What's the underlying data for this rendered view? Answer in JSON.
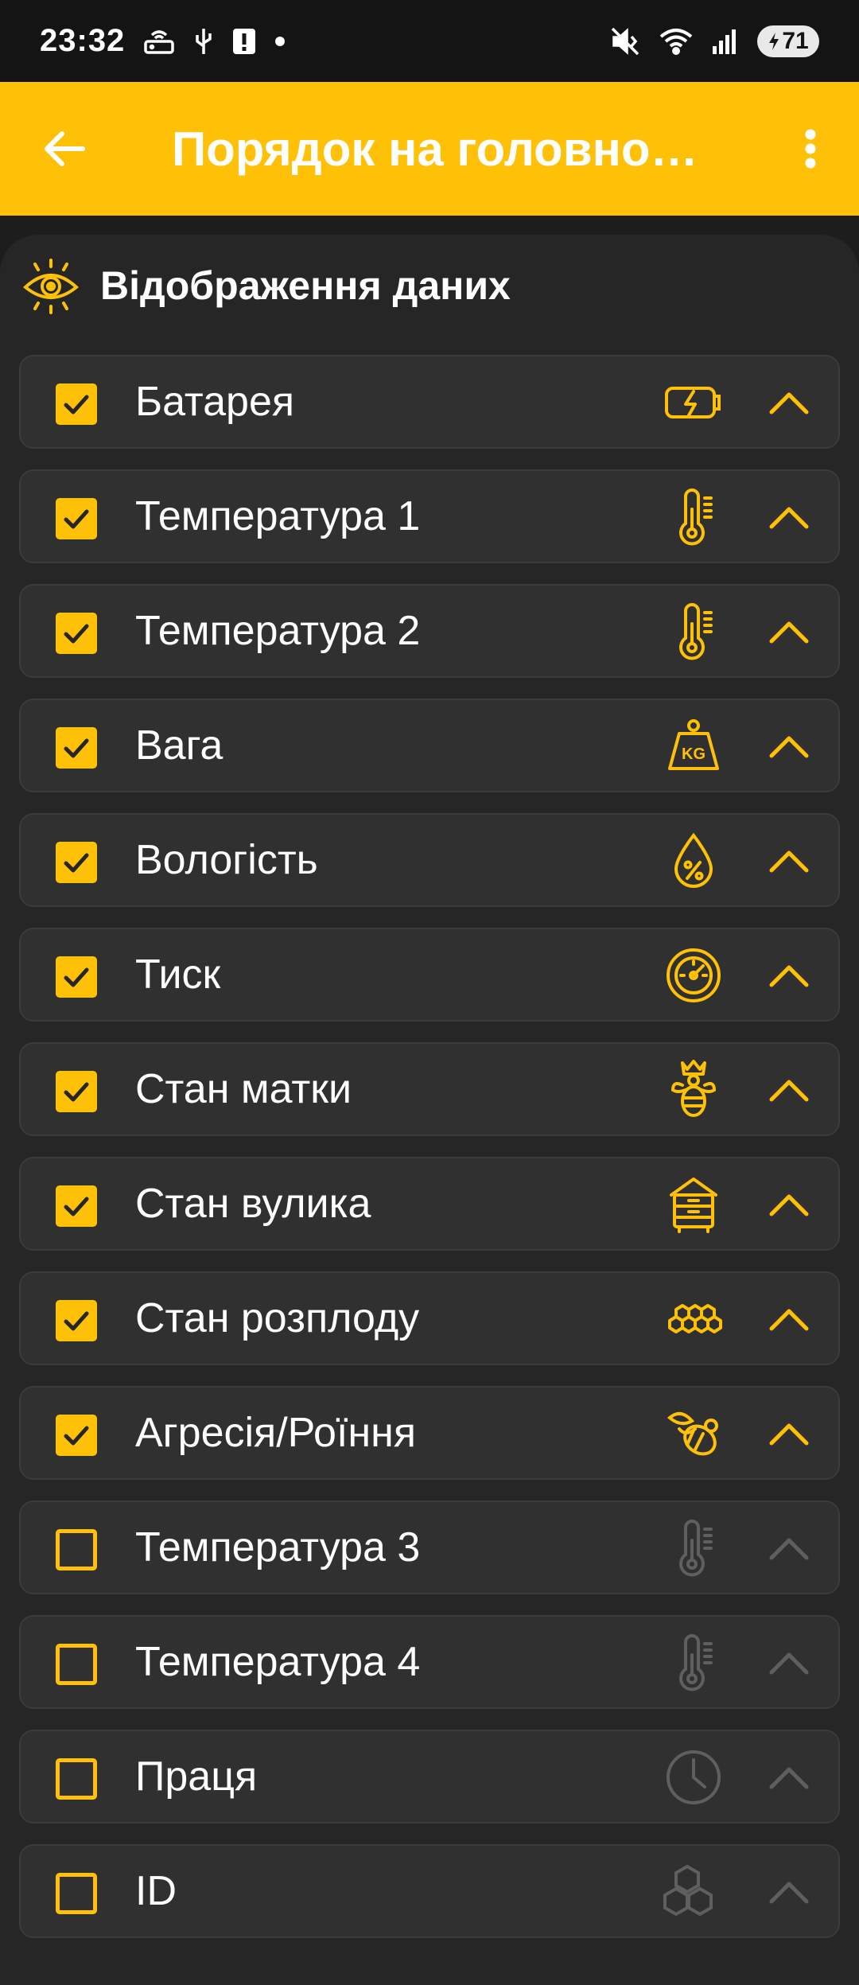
{
  "status_bar": {
    "time": "23:32",
    "icons_left": [
      "router-icon",
      "usb-icon",
      "alert-icon",
      "dot-icon"
    ],
    "icons_right": [
      "mute-vibrate-icon",
      "wifi-icon",
      "signal-icon"
    ],
    "battery": "71"
  },
  "app_bar": {
    "title": "Порядок на головно…",
    "background": "#ffc107"
  },
  "section": {
    "title": "Відображення даних",
    "icon": "eye-icon"
  },
  "colors": {
    "accent": "#ffc107",
    "disabled": "#5f5f5f"
  },
  "items": [
    {
      "label": "Батарея",
      "checked": true,
      "icon": "battery-charging-icon"
    },
    {
      "label": "Температура 1",
      "checked": true,
      "icon": "thermometer-icon"
    },
    {
      "label": "Температура 2",
      "checked": true,
      "icon": "thermometer-icon"
    },
    {
      "label": "Вага",
      "checked": true,
      "icon": "weight-kg-icon"
    },
    {
      "label": "Вологість",
      "checked": true,
      "icon": "humidity-icon"
    },
    {
      "label": "Тиск",
      "checked": true,
      "icon": "pressure-gauge-icon"
    },
    {
      "label": "Стан матки",
      "checked": true,
      "icon": "queen-bee-icon"
    },
    {
      "label": "Стан вулика",
      "checked": true,
      "icon": "beehive-icon"
    },
    {
      "label": "Стан розплоду",
      "checked": true,
      "icon": "honeycomb-icon"
    },
    {
      "label": "Агресія/Роїння",
      "checked": true,
      "icon": "bee-icon"
    },
    {
      "label": "Температура 3",
      "checked": false,
      "icon": "thermometer-icon"
    },
    {
      "label": "Температура 4",
      "checked": false,
      "icon": "thermometer-icon"
    },
    {
      "label": "Праця",
      "checked": false,
      "icon": "clock-icon"
    },
    {
      "label": "ID",
      "checked": false,
      "icon": "hexagons-icon"
    }
  ]
}
